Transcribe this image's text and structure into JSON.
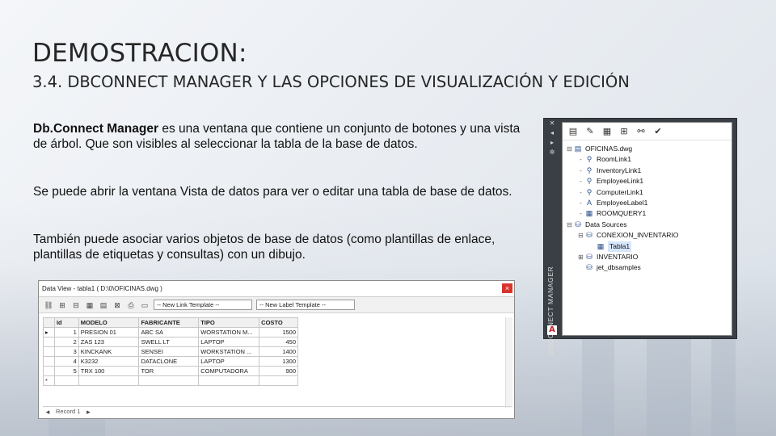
{
  "slide": {
    "title": "DEMOSTRACION:",
    "subtitle": "3.4. DBCONNECT MANAGER Y LAS OPCIONES DE VISUALIZACIÓN Y EDICIÓN",
    "para1_bold": "Db.Connect Manager",
    "para1_rest": " es una ventana que contiene un conjunto de botones y una vista de árbol. Que son visibles al seleccionar la tabla de la base de datos.",
    "para2": "Se puede abrir la ventana Vista de datos para ver o editar una tabla de base de datos.",
    "para3": "También puede asociar varios objetos de base de datos (como plantillas de enlace, plantillas de etiquetas y consultas) con un dibujo."
  },
  "data_view": {
    "title": "Data View - tabla1 ( D:\\0\\OFICINAS.dwg )",
    "close_icon": "×",
    "link_template": "-- New Link Template --",
    "label_template": "-- New Label Template --",
    "columns": [
      "Id",
      "MODELO",
      "FABRICANTE",
      "TIPO",
      "COSTO"
    ],
    "rows": [
      [
        "1",
        "PRESION 01",
        "ABC SA",
        "WORSTATION M...",
        "1500"
      ],
      [
        "2",
        "ZAS 123",
        "SWELL LT",
        "LAPTOP",
        "450"
      ],
      [
        "3",
        "KINCKANK",
        "SENSEI",
        "WORKSTATION ...",
        "1400"
      ],
      [
        "4",
        "K3232",
        "DATACLONE",
        "LAPTOP",
        "1300"
      ],
      [
        "5",
        "TRX 100",
        "TOR",
        "COMPUTADORA",
        "900"
      ]
    ],
    "status": "Record 1"
  },
  "dbconnect": {
    "side_label": "DBCONNECT MANAGER",
    "tree": [
      {
        "indent": 0,
        "twisty": "⊟",
        "icon": "▤",
        "label": "OFICINAS.dwg"
      },
      {
        "indent": 1,
        "twisty": "-",
        "icon": "⚲",
        "label": "RoomLink1"
      },
      {
        "indent": 1,
        "twisty": "-",
        "icon": "⚲",
        "label": "InventoryLink1"
      },
      {
        "indent": 1,
        "twisty": "-",
        "icon": "⚲",
        "label": "EmployeeLink1"
      },
      {
        "indent": 1,
        "twisty": "-",
        "icon": "⚲",
        "label": "ComputerLink1"
      },
      {
        "indent": 1,
        "twisty": "-",
        "icon": "A",
        "label": "EmployeeLabel1"
      },
      {
        "indent": 1,
        "twisty": "-",
        "icon": "▦",
        "label": "ROOMQUERY1"
      },
      {
        "indent": 0,
        "twisty": "⊟",
        "icon": "⛁",
        "label": "Data Sources"
      },
      {
        "indent": 1,
        "twisty": "⊟",
        "icon": "⛁",
        "label": "CONEXION_INVENTARIO"
      },
      {
        "indent": 2,
        "twisty": "",
        "icon": "▦",
        "label": "Tabla1",
        "selected": true
      },
      {
        "indent": 1,
        "twisty": "⊞",
        "icon": "⛁",
        "label": "INVENTARIO"
      },
      {
        "indent": 1,
        "twisty": "",
        "icon": "⛁",
        "label": "jet_dbsamples"
      }
    ]
  }
}
